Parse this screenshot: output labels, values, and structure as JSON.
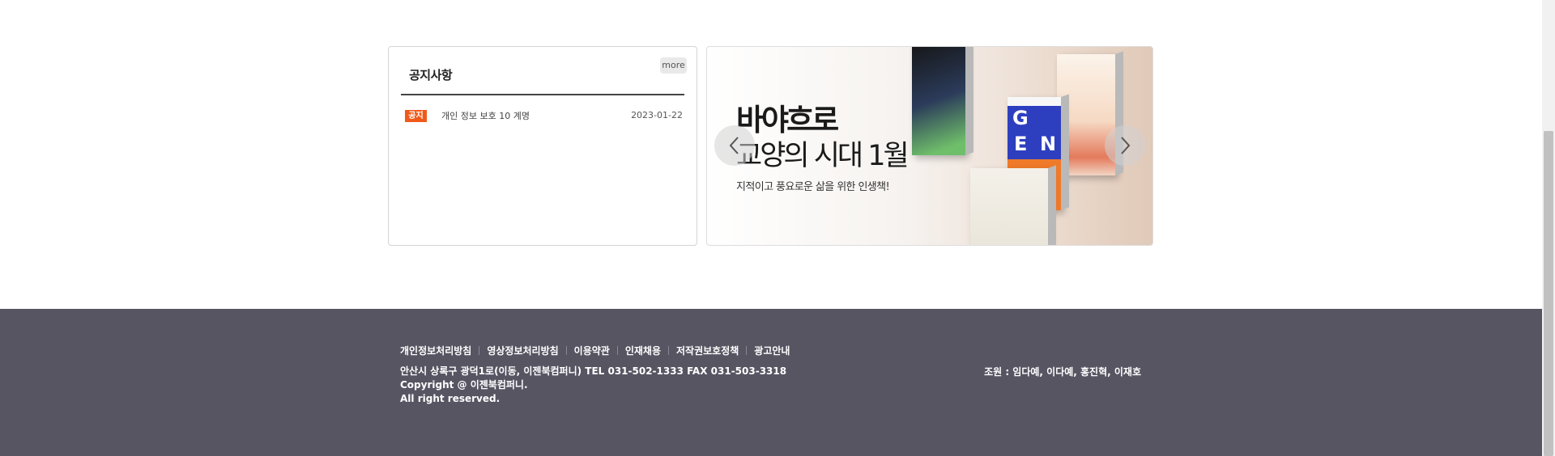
{
  "notice": {
    "title": "공지사항",
    "more_label": "more",
    "items": [
      {
        "badge": "공지",
        "text": "개인 정보 보호 10 계명",
        "date": "2023-01-22"
      }
    ]
  },
  "banner": {
    "headline1": "바야흐로",
    "headline2": "교양의 시대 1월",
    "subtext": "지적이고 풍요로운 삶을 위한 인생책!",
    "book_letters": [
      "G",
      "E",
      "N"
    ]
  },
  "footer": {
    "links": [
      "개인정보처리방침",
      "영상정보처리방침",
      "이용약관",
      "인재채용",
      "저작권보호정책",
      "광고안내"
    ],
    "address": "안산시 상록구 광덕1로(이동, 이젠북컴퍼니) TEL 031-502-1333 FAX 031-503-3318",
    "copyright": "Copyright @ 이젠북컴퍼니.",
    "rights": "All right reserved.",
    "team": "조원 : 임다예, 이다예, 홍진혁, 이재호"
  },
  "colors": {
    "badge": "#f05a19",
    "footer_bg": "#585563"
  }
}
